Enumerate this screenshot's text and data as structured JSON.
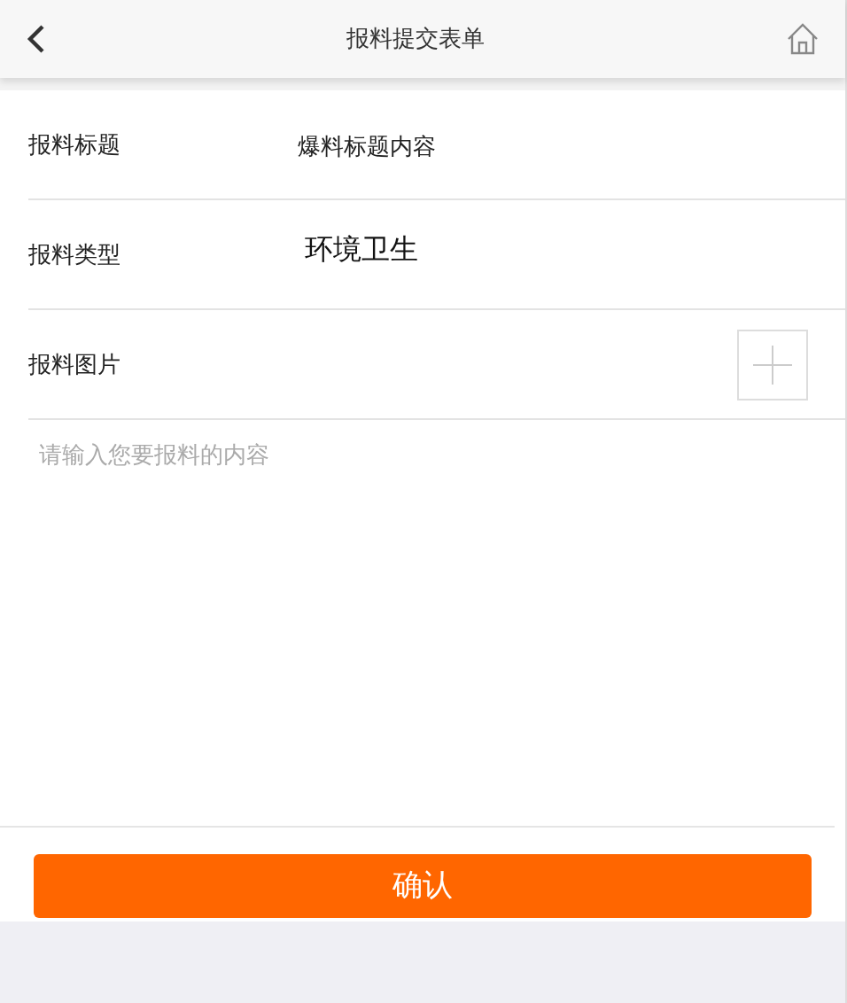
{
  "header": {
    "title": "报料提交表单"
  },
  "fields": [
    {
      "kind": "text",
      "label": "报料标题",
      "value": "爆料标题内容"
    },
    {
      "kind": "select",
      "label": "报料类型",
      "value": "环境卫生"
    },
    {
      "kind": "image",
      "label": "报料图片"
    }
  ],
  "content": {
    "placeholder": "请输入您要报料的内容"
  },
  "submit": {
    "label": "确认"
  }
}
